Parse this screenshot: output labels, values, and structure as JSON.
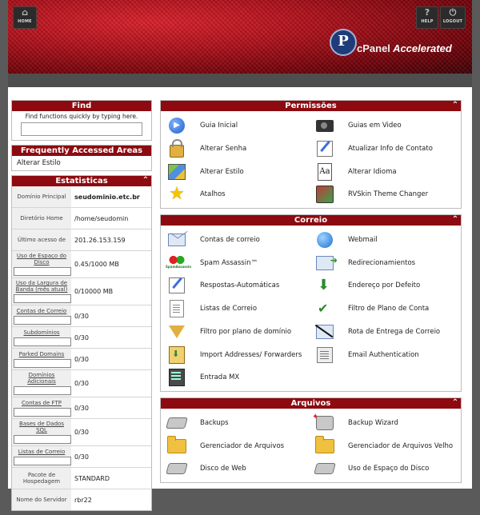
{
  "header": {
    "home_label": "HOME",
    "help_label": "HELP",
    "logout_label": "LOGOUT",
    "logo_letter": "P",
    "logo_text_cpanel": "cPanel",
    "logo_text_accelerated": "Accelerated"
  },
  "find": {
    "title": "Find",
    "hint": "Find functions quickly by typing here.",
    "value": ""
  },
  "frequent": {
    "title": "Frequently Accessed Areas",
    "items": [
      "Alterar Estilo"
    ]
  },
  "stats": {
    "title": "Estatisticas",
    "rows": [
      {
        "label": "Domínio Principal",
        "value": "seudominio.etc.br",
        "bold": true
      },
      {
        "label": "Diretório Home",
        "value": "/home/seudomin"
      },
      {
        "label": "Último acesso de",
        "value": "201.26.153.159"
      },
      {
        "label": "Uso de Espaço do Disco",
        "value": "0.45/1000 MB",
        "bar": true
      },
      {
        "label": "Uso da Largura de Banda (mês atual)",
        "value": "0/10000 MB",
        "bar": true
      },
      {
        "label": "Contas de Correio",
        "value": "0/30",
        "bar": true
      },
      {
        "label": "Subdomínios",
        "value": "0/30",
        "bar": true
      },
      {
        "label": "Parked Domains",
        "value": "0/30",
        "bar": true
      },
      {
        "label": "Domínios Adicionais",
        "value": "0/30",
        "bar": true
      },
      {
        "label": "Contas de FTP",
        "value": "0/30",
        "bar": true
      },
      {
        "label": "Bases de Dados SQL",
        "value": "0/30",
        "bar": true
      },
      {
        "label": "Listas de Correio",
        "value": "0/30",
        "bar": true
      },
      {
        "label": "Pacote de Hospedagem",
        "value": "STANDARD",
        "plain": true
      },
      {
        "label": "Nome do Servidor",
        "value": "rbr22",
        "plain": true
      }
    ]
  },
  "permissoes": {
    "title": "Permissões",
    "items": [
      {
        "label": "Guia Inicial",
        "icon": "play-circle-icon",
        "cls": "i-circle",
        "glyph": "▶"
      },
      {
        "label": "Guias em Video",
        "icon": "video-camera-icon",
        "cls": "i-camera",
        "glyph": ""
      },
      {
        "label": "Alterar Senha",
        "icon": "lock-password-icon",
        "cls": "i-lock",
        "glyph": ""
      },
      {
        "label": "Atualizar Info de Contato",
        "icon": "contact-edit-icon",
        "cls": "i-edit",
        "glyph": ""
      },
      {
        "label": "Alterar Estilo",
        "icon": "style-palette-icon",
        "cls": "i-paint",
        "glyph": ""
      },
      {
        "label": "Alterar Idioma",
        "icon": "language-icon",
        "cls": "i-aa",
        "glyph": "Aa"
      },
      {
        "label": "Atalhos",
        "icon": "star-shortcut-icon",
        "cls": "i-star",
        "glyph": "★"
      },
      {
        "label": "RVSkin Theme Changer",
        "icon": "theme-changer-icon",
        "cls": "i-theme",
        "glyph": ""
      }
    ]
  },
  "correio": {
    "title": "Correio",
    "items": [
      {
        "label": "Contas de correio",
        "icon": "envelope-icon",
        "cls": "i-env",
        "glyph": ""
      },
      {
        "label": "Webmail",
        "icon": "globe-mail-icon",
        "cls": "i-globe",
        "glyph": ""
      },
      {
        "label": "Spam Assassin™",
        "icon": "spam-assassin-icon",
        "cls": "i-spam",
        "glyph": "SpamAssassin"
      },
      {
        "label": "Redirecionamientos",
        "icon": "mail-forward-icon",
        "cls": "i-redirect",
        "glyph": ""
      },
      {
        "label": "Respostas-Automáticas",
        "icon": "autoresponder-icon",
        "cls": "i-edit",
        "glyph": ""
      },
      {
        "label": "Endereço por Defeito",
        "icon": "default-address-icon",
        "cls": "i-down",
        "glyph": "⬇"
      },
      {
        "label": "Listas de Correio",
        "icon": "mailing-list-icon",
        "cls": "i-doc",
        "glyph": ""
      },
      {
        "label": "Filtro de Plano de Conta",
        "icon": "account-filter-icon",
        "cls": "i-check",
        "glyph": "✔"
      },
      {
        "label": "Filtro por plano de domínio",
        "icon": "domain-filter-icon",
        "cls": "i-funnel",
        "glyph": ""
      },
      {
        "label": "Rota de Entrega de Correio",
        "icon": "mail-route-icon",
        "cls": "i-route",
        "glyph": ""
      },
      {
        "label": "Import Addresses/ Forwarders",
        "icon": "import-icon",
        "cls": "i-import",
        "glyph": ""
      },
      {
        "label": "Email Authentication",
        "icon": "email-auth-icon",
        "cls": "i-auth",
        "glyph": ""
      },
      {
        "label": "Entrada MX",
        "icon": "mx-server-icon",
        "cls": "i-mx",
        "glyph": ""
      }
    ]
  },
  "arquivos": {
    "title": "Arquivos",
    "items": [
      {
        "label": "Backups",
        "icon": "backup-drive-icon",
        "cls": "i-disk",
        "glyph": ""
      },
      {
        "label": "Backup Wizard",
        "icon": "backup-wizard-icon",
        "cls": "i-wizard",
        "glyph": ""
      },
      {
        "label": "Gerenciador de Arquivos",
        "icon": "folder-icon",
        "cls": "i-folder",
        "glyph": ""
      },
      {
        "label": "Gerenciador de Arquivos Velho",
        "icon": "folder-old-icon",
        "cls": "i-folder",
        "glyph": ""
      },
      {
        "label": "Disco de Web",
        "icon": "web-disk-icon",
        "cls": "i-disk",
        "glyph": ""
      },
      {
        "label": "Uso de Espaço do Disco",
        "icon": "disk-usage-icon",
        "cls": "i-disk",
        "glyph": ""
      }
    ]
  }
}
